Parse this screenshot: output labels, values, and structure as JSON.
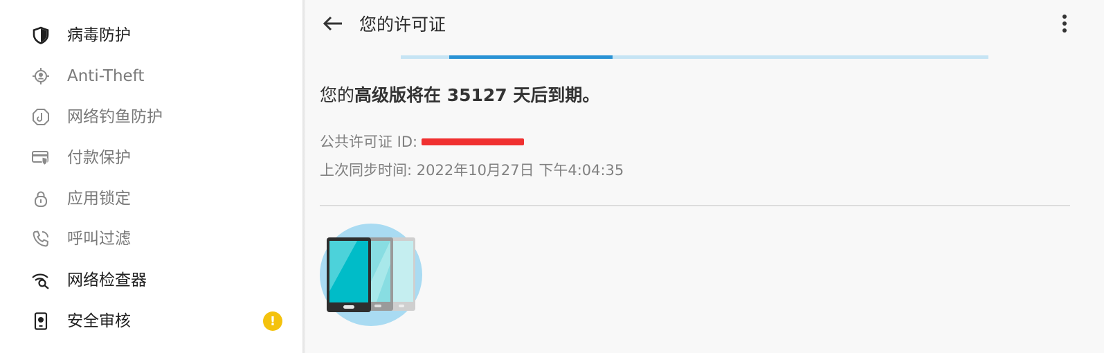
{
  "sidebar": {
    "items": [
      {
        "label": "病毒防护",
        "icon": "shield-icon",
        "state": "active"
      },
      {
        "label": "Anti-Theft",
        "icon": "anti-theft-icon",
        "state": "inactive"
      },
      {
        "label": "网络钓鱼防护",
        "icon": "phishing-hook-icon",
        "state": "inactive"
      },
      {
        "label": "付款保护",
        "icon": "payment-card-shield-icon",
        "state": "inactive"
      },
      {
        "label": "应用锁定",
        "icon": "padlock-icon",
        "state": "inactive"
      },
      {
        "label": "呼叫过滤",
        "icon": "phone-icon",
        "state": "inactive"
      },
      {
        "label": "网络检查器",
        "icon": "wifi-search-icon",
        "state": "active"
      },
      {
        "label": "安全审核",
        "icon": "device-audit-icon",
        "state": "active",
        "badge": "!"
      }
    ]
  },
  "header": {
    "back_icon": "back-arrow-icon",
    "title": "您的许可证",
    "more_icon": "more-vertical-icon"
  },
  "progress": {
    "start_fraction": 0.083,
    "fill_fraction": 0.278,
    "fill_color": "#2a93d5",
    "track_color": "#c6e4f4"
  },
  "license": {
    "expiry_prefix": "您的",
    "expiry_bold": "高级版将在 35127 天后到期。",
    "public_id_label": "公共许可证 ID:",
    "public_id_redacted": true,
    "last_sync_label": "上次同步时间:",
    "last_sync_value": "2022年10月27日 下午4:04:35"
  },
  "illustration": {
    "icon": "multi-device-phones-icon"
  },
  "colors": {
    "accent": "#2a93d5",
    "badge": "#f4c20d",
    "redaction": "#f03030"
  }
}
